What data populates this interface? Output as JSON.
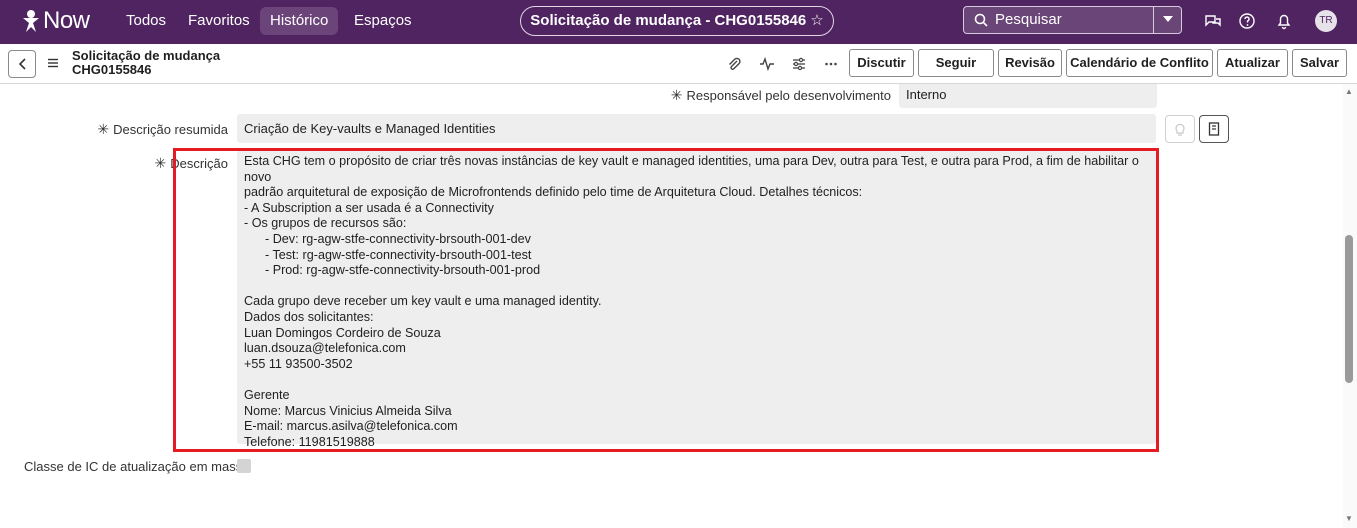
{
  "nav": {
    "logo_text": "Now",
    "items": [
      "Todos",
      "Favoritos",
      "Histórico",
      "Espaços"
    ],
    "record_title": "Solicitação de mudança - CHG0155846",
    "star": "☆",
    "search_placeholder": "Pesquisar",
    "avatar_initials": "TR"
  },
  "header": {
    "title_line1": "Solicitação de mudança",
    "title_line2": "CHG0155846",
    "buttons": [
      "Discutir",
      "Seguir",
      "Revisão",
      "Calendário de Conflito",
      "Atualizar",
      "Salvar"
    ]
  },
  "form": {
    "responsible_label": "Responsável pelo desenvolvimento",
    "responsible_value": "Interno",
    "short_desc_label": "Descrição resumida",
    "short_desc_value": "Criação de Key-vaults e Managed Identities",
    "desc_label": "Descrição",
    "desc_value": "Esta CHG tem o propósito de criar três novas instâncias de key vault e managed identities, uma para Dev, outra para Test, e outra para Prod, a fim de habilitar o novo\npadrão arquitetural de exposição de Microfrontends definido pelo time de Arquitetura Cloud. Detalhes técnicos:\n- A Subscription a ser usada é a Connectivity\n- Os grupos de recursos são:\n      - Dev: rg-agw-stfe-connectivity-brsouth-001-dev\n      - Test: rg-agw-stfe-connectivity-brsouth-001-test\n      - Prod: rg-agw-stfe-connectivity-brsouth-001-prod\n\nCada grupo deve receber um key vault e uma managed identity.\nDados dos solicitantes:\nLuan Domingos Cordeiro de Souza\nluan.dsouza@telefonica.com\n+55 11 93500-3502\n\nGerente\nNome: Marcus Vinicius Almeida Silva\nE-mail: marcus.asilva@telefonica.com\nTelefone: 11981519888",
    "mass_update_label": "Classe de IC de atualização em massa"
  },
  "colors": {
    "nav_bg": "#4f2461",
    "highlight": "#e41b23",
    "field_bg": "#eeeeee"
  }
}
